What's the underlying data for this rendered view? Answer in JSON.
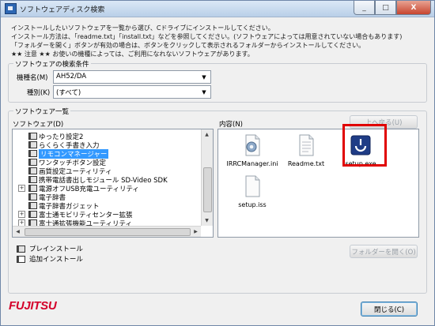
{
  "window": {
    "title": "ソフトウェアディスク検索",
    "buttons": {
      "minimize": "_",
      "maximize": "□",
      "close": "X"
    }
  },
  "instructions": [
    "インストールしたいソフトウェアを一覧から選び、Cドライブにインストールしてください。",
    "インストール方法は、「readme.txt」「install.txt」などを参照してください。(ソフトウェアによっては用意されていない場合もあります)",
    "「フォルダーを開く」ボタンが有効の場合は、ボタンをクリックして表示されるフォルダーからインストールしてください。",
    "★★ 注意 ★★ お使いの機種によっては、ご利用になれないソフトウェアがあります。"
  ],
  "search": {
    "group_label": "ソフトウェアの検索条件",
    "model_label": "機種名(M)",
    "model_value": "AH52/DA",
    "type_label": "種別(K)",
    "type_value": "(すべて)"
  },
  "list": {
    "group_label": "ソフトウェア一覧",
    "software_label": "ソフトウェア(D)",
    "items": [
      {
        "label": "ゆったり設定2",
        "expandable": false,
        "selected": false
      },
      {
        "label": "らくらく手書き入力",
        "expandable": false,
        "selected": false
      },
      {
        "label": "リモコンマネージャー",
        "expandable": false,
        "selected": true
      },
      {
        "label": "ワンタッチボタン設定",
        "expandable": false,
        "selected": false
      },
      {
        "label": "画質設定ユーティリティ",
        "expandable": false,
        "selected": false
      },
      {
        "label": "携帯電話書出しモジュール SD-Video SDK",
        "expandable": false,
        "selected": false
      },
      {
        "label": "電源オフUSB充電ユーティリティ",
        "expandable": true,
        "selected": false
      },
      {
        "label": "電子辞書",
        "expandable": false,
        "selected": false
      },
      {
        "label": "電子辞書ガジェット",
        "expandable": false,
        "selected": false
      },
      {
        "label": "富士通モビリティセンター拡張",
        "expandable": true,
        "selected": false
      },
      {
        "label": "富士通拡張機能ユーティリティ",
        "expandable": true,
        "selected": false
      }
    ],
    "contents_label": "内容(N)",
    "back_button": "上へ戻る(U)",
    "files": [
      {
        "name": "IRRCManager.ini",
        "icon": "ini-settings-icon"
      },
      {
        "name": "Readme.txt",
        "icon": "text-file-icon"
      },
      {
        "name": "setup.exe",
        "icon": "setup-exe-icon"
      },
      {
        "name": "setup.iss",
        "icon": "iss-file-icon"
      }
    ],
    "highlighted_file": "setup.exe",
    "highlight_color": "#e00000",
    "legend_preinstall": "プレインストール",
    "legend_additional": "追加インストール",
    "open_folder_button": "フォルダーを開く(O)"
  },
  "footer": {
    "logo": "FUJITSU",
    "close_button": "閉じる(C)"
  }
}
